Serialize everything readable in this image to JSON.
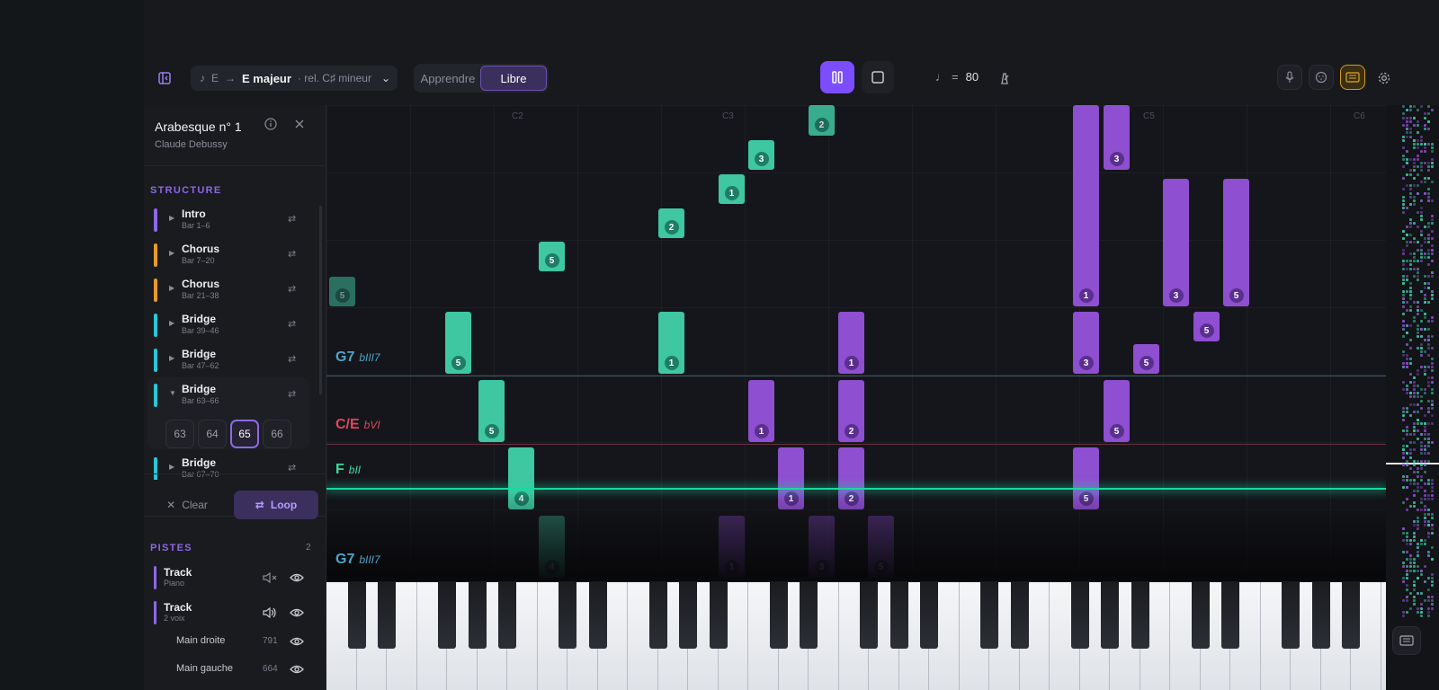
{
  "key_selector": {
    "note_icon": "♪",
    "from": "E",
    "arrow": "→",
    "key": "E majeur",
    "relative": "· rel. C♯ mineur",
    "chevron": "⌄"
  },
  "mode_tabs": {
    "learn": "Apprendre",
    "free": "Libre",
    "active": "Libre"
  },
  "transport": {
    "tempo_symbol": "♩",
    "tempo_eq": "=",
    "tempo_value": "80"
  },
  "song": {
    "title": "Arabesque n° 1",
    "composer": "Claude Debussy"
  },
  "structure": {
    "title": "STRUCTURE",
    "sections": [
      {
        "name": "Intro",
        "bars": "Bar 1–6",
        "color": "#8e67e8",
        "expanded": false
      },
      {
        "name": "Chorus",
        "bars": "Bar 7–20",
        "color": "#e89a2c",
        "expanded": false
      },
      {
        "name": "Chorus",
        "bars": "Bar 21–38",
        "color": "#e89a2c",
        "expanded": false
      },
      {
        "name": "Bridge",
        "bars": "Bar 39–46",
        "color": "#28c8d8",
        "expanded": false
      },
      {
        "name": "Bridge",
        "bars": "Bar 47–62",
        "color": "#28c8d8",
        "expanded": false
      },
      {
        "name": "Bridge",
        "bars": "Bar 63–66",
        "color": "#28c8d8",
        "expanded": true
      },
      {
        "name": "Bridge",
        "bars": "Bar 67–70",
        "color": "#28c8d8",
        "expanded": false
      }
    ],
    "bar_buttons": [
      "63",
      "64",
      "65",
      "66"
    ],
    "selected_bar": "65",
    "clear_label": "Clear",
    "loop_label": "Loop"
  },
  "tracks": {
    "title": "PISTES",
    "count": "2",
    "items": [
      {
        "name": "Track",
        "sub": "Piano"
      },
      {
        "name": "Track",
        "sub": "2 voix"
      }
    ],
    "voices": [
      {
        "name": "Main droite",
        "count": "791"
      },
      {
        "name": "Main gauche",
        "count": "664"
      }
    ]
  },
  "octave_labels": [
    "C2",
    "C3",
    "C5",
    "C6"
  ],
  "chords": [
    {
      "name": "G7",
      "degree": "bIII7",
      "color": "#4fa3c7"
    },
    {
      "name": "C/E",
      "degree": "bVI",
      "color": "#e0455e"
    },
    {
      "name": "F",
      "degree": "bII",
      "color": "#3fd9a0"
    },
    {
      "name": "G7",
      "degree": "bIII7",
      "color": "#4fa3c7"
    }
  ],
  "notes_fingers": [
    "2",
    "3",
    "1",
    "2",
    "5",
    "5",
    "3",
    "3",
    "3",
    "5",
    "5",
    "5",
    "1",
    "1",
    "1",
    "3",
    "5",
    "5",
    "1",
    "2",
    "5",
    "4",
    "1",
    "2",
    "5",
    "4",
    "1",
    "3",
    "5"
  ],
  "colors": {
    "accent": "#7c4dff",
    "green_note": "#3fc7a2",
    "purple_note": "#8e4fd0",
    "playhead": "#19d9a0"
  }
}
